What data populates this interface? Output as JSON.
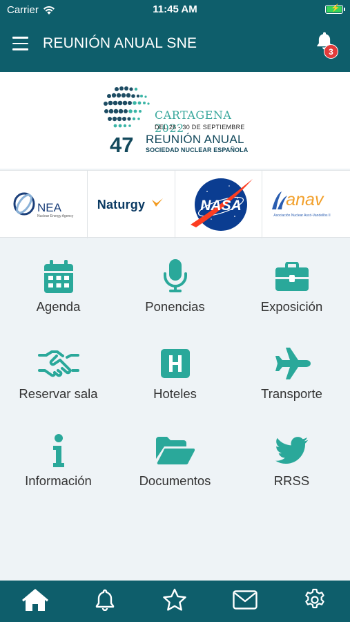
{
  "status_bar": {
    "carrier": "Carrier",
    "time": "11:45 AM"
  },
  "header": {
    "title": "REUNIÓN ANUAL SNE",
    "notification_count": "3"
  },
  "conference": {
    "city_year": "CARTAGENA 2022",
    "dates": "DEL 26 - 30 DE SEPTIEMBRE",
    "edition": "47",
    "name": "REUNIÓN ANUAL",
    "society": "SOCIEDAD NUCLEAR ESPAÑOLA"
  },
  "sponsors": [
    {
      "name": "NEA",
      "subtitle": "Nuclear Energy Agency"
    },
    {
      "name": "Naturgy"
    },
    {
      "name": "NASA"
    },
    {
      "name": "anav",
      "subtitle": "Asociación Nuclear Ascó-Vandellòs II"
    }
  ],
  "menu": [
    {
      "label": "Agenda",
      "icon": "calendar-icon"
    },
    {
      "label": "Ponencias",
      "icon": "microphone-icon"
    },
    {
      "label": "Exposición",
      "icon": "toolbox-icon"
    },
    {
      "label": "Reservar sala",
      "icon": "handshake-icon"
    },
    {
      "label": "Hoteles",
      "icon": "hospital-h-icon"
    },
    {
      "label": "Transporte",
      "icon": "plane-icon"
    },
    {
      "label": "Información",
      "icon": "info-icon"
    },
    {
      "label": "Documentos",
      "icon": "folder-open-icon"
    },
    {
      "label": "RRSS",
      "icon": "twitter-icon"
    }
  ],
  "tabs": [
    {
      "icon": "home-icon"
    },
    {
      "icon": "bell-icon"
    },
    {
      "icon": "star-icon"
    },
    {
      "icon": "envelope-icon"
    },
    {
      "icon": "gear-icon"
    }
  ],
  "colors": {
    "brand": "#0e5e6b",
    "accent": "#2aa89a",
    "badge": "#e23b3b",
    "background": "#eef3f6"
  }
}
